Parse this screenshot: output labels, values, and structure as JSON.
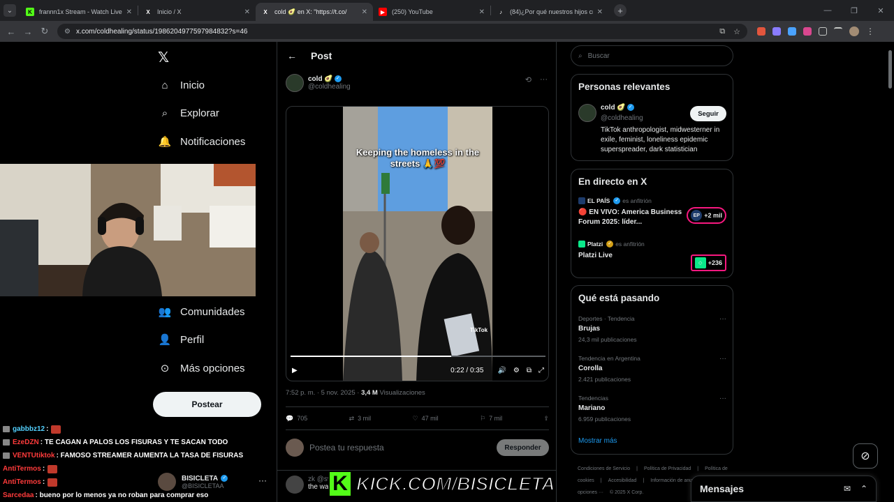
{
  "browser": {
    "tabs": [
      {
        "label": "frannn1x Stream - Watch Live o",
        "icon": "kick-favicon",
        "color": "#53fc18",
        "glyph": "K"
      },
      {
        "label": "Inicio / X",
        "icon": "x-favicon",
        "color": "#ffffff",
        "glyph": "X"
      },
      {
        "label": "cold 🥑 en X: \"https://t.co/",
        "icon": "x-favicon",
        "color": "#ffffff",
        "glyph": "X"
      },
      {
        "label": "(250) YouTube",
        "icon": "youtube-favicon",
        "color": "#ff0000",
        "glyph": "▶"
      },
      {
        "label": "(84)¿Por qué nuestros hijos cre",
        "icon": "tiktok-favicon",
        "color": "#ffffff",
        "glyph": "♪"
      }
    ],
    "active_tab": 2,
    "url": "x.com/coldhealing/status/1986204977597984832?s=46"
  },
  "left_nav": {
    "items": [
      {
        "label": "Inicio",
        "icon": "home-icon"
      },
      {
        "label": "Explorar",
        "icon": "search-icon"
      },
      {
        "label": "Notificaciones",
        "icon": "bell-icon"
      },
      {
        "label": "Comunidades",
        "icon": "people-icon"
      },
      {
        "label": "Perfil",
        "icon": "person-icon"
      },
      {
        "label": "Más opciones",
        "icon": "more-circle-icon"
      }
    ],
    "post_button": "Postear",
    "account": {
      "name": "BISICLETA",
      "handle": "@BISICLETAA"
    }
  },
  "chat": [
    {
      "user": "gabbbz12",
      "color": "#53d1ff",
      "text": " : ",
      "emote": true
    },
    {
      "user": "EzeDZN",
      "color": "#ff3b3b",
      "text": " : TE CAGAN A PALOS LOS FISURAS Y TE SACAN TODO",
      "emote": false
    },
    {
      "user": "VENTUtiktok",
      "color": "#ff3b3b",
      "text": " : FAMOSO STREAMER AUMENTA LA TASA DE FISURAS",
      "emote": false
    },
    {
      "user": "AntiTermos",
      "color": "#ff3b3b",
      "text": " : ",
      "emote": true
    },
    {
      "user": "AntiTermos",
      "color": "#ff3b3b",
      "text": " : ",
      "emote": true
    },
    {
      "user": "Sarcedaa",
      "color": "#ff3b3b",
      "text": " : bueno por lo menos ya no roban para comprar eso",
      "emote": false
    }
  ],
  "post": {
    "header_title": "Post",
    "author_name": "cold 🥑",
    "author_handle": "@coldhealing",
    "video_caption": "Keeping the homeless in the streets 🙏💯",
    "video_time": "0:22 / 0:35",
    "video_progress": 0.63,
    "watermark": "TikTok",
    "timestamp": "7:52 p. m. · 5 nov. 2025 · ",
    "views_value": "3,4 M",
    "views_label": " Visualizaciones",
    "replies": "705",
    "reposts": "3 mil",
    "likes": "47 mil",
    "bookmarks": "7 mil",
    "reply_placeholder": "Postea tu respuesta",
    "reply_button": "Responder",
    "comment": {
      "name": "zk",
      "handle": "@sv",
      "text": "the wa"
    }
  },
  "right": {
    "search_placeholder": "Buscar",
    "relevant": {
      "title": "Personas relevantes",
      "name": "cold 🥑",
      "handle": "@coldhealing",
      "bio": "TikTok anthropologist, midwesterner in exile, feminist, loneliness epidemic superspreader, dark statistician",
      "follow": "Seguir"
    },
    "live": {
      "title": "En directo en X",
      "items": [
        {
          "host": "EL PAÍS",
          "host_suffix": "es anfitrión",
          "title": "🔴 EN VIVO: America Business Forum 2025: líder...",
          "count": "+2 mil",
          "badge": "EP",
          "badge_color": "#1d3b6b"
        },
        {
          "host": "Platzi",
          "host_suffix": "es anfitrión",
          "title": "Platzi Live",
          "count": "+236",
          "badge": "◇",
          "badge_color": "#0ae98a"
        }
      ]
    },
    "trends": {
      "title": "Qué está pasando",
      "items": [
        {
          "category": "Deportes · Tendencia",
          "name": "Brujas",
          "count": "24,3 mil publicaciones"
        },
        {
          "category": "Tendencia en Argentina",
          "name": "Corolla",
          "count": "2.421 publicaciones"
        },
        {
          "category": "Tendencias",
          "name": "Mariano",
          "count": "6.959 publicaciones"
        }
      ],
      "show_more": "Mostrar más"
    },
    "footer": [
      "Condiciones de Servicio",
      "|",
      "Política de Privacidad",
      "|",
      "Política de cookies",
      "|",
      "Accesibilidad",
      "|",
      "Información de anuncios",
      "|",
      "Más opciones ···",
      "© 2025 X Corp."
    ],
    "messages": "Mensajes"
  },
  "overlay": {
    "kick_url": "KICK.COM/BISICLETA",
    "kick_letter": "K"
  }
}
